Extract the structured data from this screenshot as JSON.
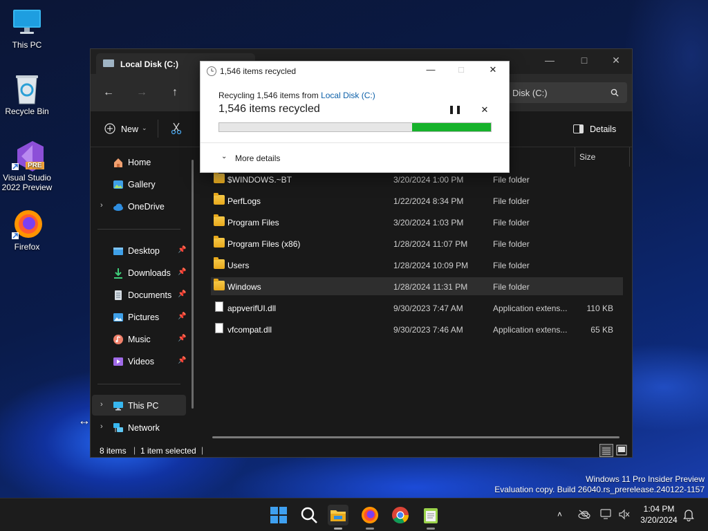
{
  "desktop": {
    "icons": [
      {
        "label": "This PC",
        "icon": "monitor-icon"
      },
      {
        "label": "Recycle Bin",
        "icon": "recycle-bin-icon"
      },
      {
        "label": "Visual Studio 2022 Preview",
        "badge": "PRE",
        "icon": "visual-studio-icon"
      },
      {
        "label": "Firefox",
        "icon": "firefox-icon"
      }
    ],
    "watermark": {
      "line1": "Windows 11 Pro Insider Preview",
      "line2": "Evaluation copy. Build 26040.rs_prerelease.240122-1157"
    }
  },
  "explorer": {
    "tab_title": "Local Disk (C:)",
    "search_text": "Disk (C:)",
    "toolbar": {
      "new_label": "New",
      "details_label": "Details"
    },
    "sidebar": {
      "top": [
        {
          "label": "Home",
          "icon": "home-icon"
        },
        {
          "label": "Gallery",
          "icon": "gallery-icon"
        },
        {
          "label": "OneDrive",
          "icon": "onedrive-icon"
        }
      ],
      "pinned": [
        {
          "label": "Desktop",
          "icon": "desktop-folder-icon"
        },
        {
          "label": "Downloads",
          "icon": "downloads-icon"
        },
        {
          "label": "Documents",
          "icon": "documents-icon"
        },
        {
          "label": "Pictures",
          "icon": "pictures-icon"
        },
        {
          "label": "Music",
          "icon": "music-icon"
        },
        {
          "label": "Videos",
          "icon": "videos-icon"
        }
      ],
      "bottom": [
        {
          "label": "This PC",
          "icon": "this-pc-icon"
        },
        {
          "label": "Network",
          "icon": "network-icon"
        }
      ]
    },
    "columns": {
      "size": "Size"
    },
    "files": [
      {
        "name": "$WINDOWS.~BT",
        "date": "3/20/2024 1:00 PM",
        "type": "File folder",
        "size": "",
        "kind": "folder"
      },
      {
        "name": "PerfLogs",
        "date": "1/22/2024 8:34 PM",
        "type": "File folder",
        "size": "",
        "kind": "folder"
      },
      {
        "name": "Program Files",
        "date": "3/20/2024 1:03 PM",
        "type": "File folder",
        "size": "",
        "kind": "folder"
      },
      {
        "name": "Program Files (x86)",
        "date": "1/28/2024 11:07 PM",
        "type": "File folder",
        "size": "",
        "kind": "folder"
      },
      {
        "name": "Users",
        "date": "1/28/2024 10:09 PM",
        "type": "File folder",
        "size": "",
        "kind": "folder"
      },
      {
        "name": "Windows",
        "date": "1/28/2024 11:31 PM",
        "type": "File folder",
        "size": "",
        "kind": "folder"
      },
      {
        "name": "appverifUI.dll",
        "date": "9/30/2023 7:47 AM",
        "type": "Application extens...",
        "size": "110 KB",
        "kind": "file"
      },
      {
        "name": "vfcompat.dll",
        "date": "9/30/2023 7:46 AM",
        "type": "Application extens...",
        "size": "65 KB",
        "kind": "file"
      }
    ],
    "status": {
      "count": "8 items",
      "selection": "1 item selected"
    }
  },
  "dialog": {
    "title": "1,546 items recycled",
    "subtitle_prefix": "Recycling 1,546 items from ",
    "subtitle_link": "Local Disk (C:)",
    "heading": "1,546 items recycled",
    "progress_fraction": 0.29,
    "more_details": "More details",
    "accent": "#16b22b"
  },
  "taskbar": {
    "time": "1:04 PM",
    "date": "3/20/2024"
  }
}
